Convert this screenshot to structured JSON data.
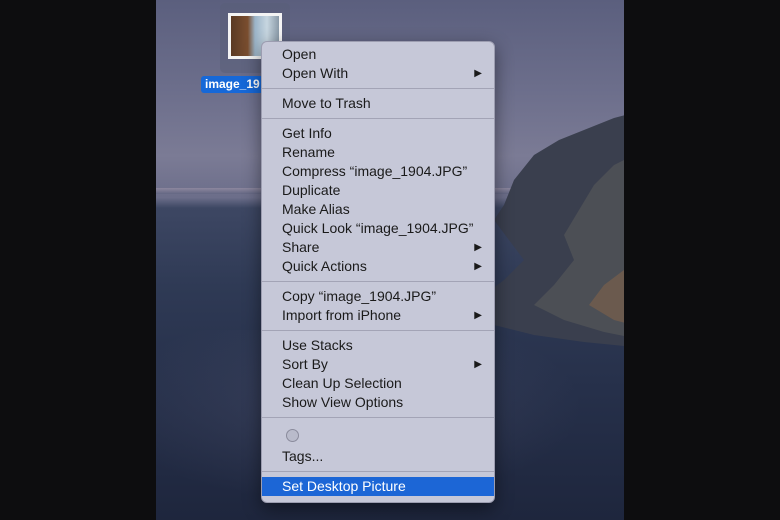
{
  "desktop": {
    "file": {
      "label": "image_19",
      "icon": "image-file-icon"
    }
  },
  "menu": {
    "group1": [
      {
        "label": "Open",
        "submenu": false
      },
      {
        "label": "Open With",
        "submenu": true
      }
    ],
    "group2": [
      {
        "label": "Move to Trash",
        "submenu": false
      }
    ],
    "group3": [
      {
        "label": "Get Info",
        "submenu": false
      },
      {
        "label": "Rename",
        "submenu": false
      },
      {
        "label": "Compress “image_1904.JPG”",
        "submenu": false
      },
      {
        "label": "Duplicate",
        "submenu": false
      },
      {
        "label": "Make Alias",
        "submenu": false
      },
      {
        "label": "Quick Look “image_1904.JPG”",
        "submenu": false
      },
      {
        "label": "Share",
        "submenu": true
      },
      {
        "label": "Quick Actions",
        "submenu": true
      }
    ],
    "group4": [
      {
        "label": "Copy “image_1904.JPG”",
        "submenu": false
      },
      {
        "label": "Import from iPhone",
        "submenu": true
      }
    ],
    "group5": [
      {
        "label": "Use Stacks",
        "submenu": false
      },
      {
        "label": "Sort By",
        "submenu": true
      },
      {
        "label": "Clean Up Selection",
        "submenu": false
      },
      {
        "label": "Show View Options",
        "submenu": false
      }
    ],
    "tags_label": "Tags...",
    "set_desktop_label": "Set Desktop Picture",
    "arrow_glyph": "▶",
    "highlight_color": "#1c66d6"
  }
}
